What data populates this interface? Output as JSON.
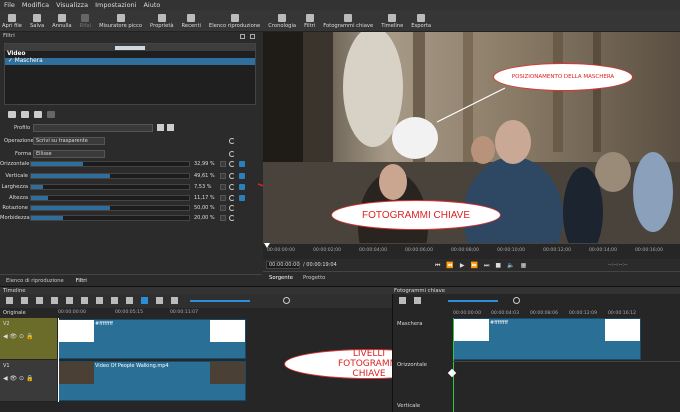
{
  "menu": [
    "File",
    "Modifica",
    "Visualizza",
    "Impostazioni",
    "Aiuto"
  ],
  "toolbar": [
    {
      "label": "Apri file",
      "disabled": false
    },
    {
      "label": "Salva",
      "disabled": false
    },
    {
      "label": "Annulla",
      "disabled": false
    },
    {
      "label": "Rifai",
      "disabled": true
    },
    {
      "label": "Misuratore picco",
      "disabled": false
    },
    {
      "label": "Proprietà",
      "disabled": false
    },
    {
      "label": "Recenti",
      "disabled": false
    },
    {
      "label": "Elenco riproduzione",
      "disabled": false
    },
    {
      "label": "Cronologia",
      "disabled": false
    },
    {
      "label": "Filtri",
      "disabled": false
    },
    {
      "label": "Fotogrammi chiave",
      "disabled": false
    },
    {
      "label": "Timeline",
      "disabled": false
    },
    {
      "label": "Esporta",
      "disabled": false
    }
  ],
  "filters": {
    "title": "Filtri",
    "section": "Video",
    "selected": "✓ Maschera",
    "profile_label": "Profilo",
    "operation_label": "Operazione",
    "operation_value": "Scrivi su trasparente",
    "shape_label": "Forma",
    "shape_value": "Ellisse",
    "params": [
      {
        "label": "Orizzontale",
        "value": "32,99 %",
        "fraction": 0.33,
        "keyframe": true
      },
      {
        "label": "Verticale",
        "value": "49,61 %",
        "fraction": 0.5,
        "keyframe": true
      },
      {
        "label": "Larghezza",
        "value": "7,53 %",
        "fraction": 0.075,
        "keyframe": true
      },
      {
        "label": "Altezza",
        "value": "11,17 %",
        "fraction": 0.11,
        "keyframe": true
      },
      {
        "label": "Rotazione",
        "value": "50,00 %",
        "fraction": 0.5,
        "keyframe": false
      },
      {
        "label": "Morbidezza",
        "value": "20,00 %",
        "fraction": 0.2,
        "keyframe": false
      }
    ]
  },
  "left_tabs": [
    "Elenco di riproduzione",
    "Filtri"
  ],
  "annotations": {
    "mask_position": "POSIZIONAMENTO DELLA MASCHERA",
    "keyframes": "FOTOGRAMMI CHIAVE",
    "keyframe_levels": "LIVELLI FOTOGRAMMI CHIAVE"
  },
  "player": {
    "ruler": [
      "00:00:00:00",
      "00:00:02;00",
      "00:00:04;00",
      "00:00:06;00",
      "00:00:08;00",
      "00:00:10;00",
      "00:00:12;00",
      "00:00:14;00",
      "00:00:16;00"
    ],
    "current": "00:00:00:00",
    "total": "/ 00:00:19:04",
    "end_time": "--:--:--:--",
    "tabs": [
      "Sorgente",
      "Progetto"
    ]
  },
  "timeline": {
    "title": "Timeline",
    "keyframes_title": "Fotogrammi chiave",
    "master_label": "Originale",
    "ruler": [
      "00:00:00:00",
      "00:00:05:15",
      "00:00:11:07"
    ],
    "tracks": [
      {
        "name": "V2",
        "clip": "#ffffffff"
      },
      {
        "name": "V1",
        "clip": "Video Of People Walking.mp4"
      }
    ]
  },
  "keyframes": {
    "ruler": [
      "00:00:00:00",
      "00:00:04:03",
      "00:00:08:06",
      "00:00:12:09",
      "00:00:16:12"
    ],
    "mask_label": "Maschera",
    "clip_label": "#ffffffff",
    "rows": [
      "Orizzontale",
      "Verticale"
    ]
  }
}
